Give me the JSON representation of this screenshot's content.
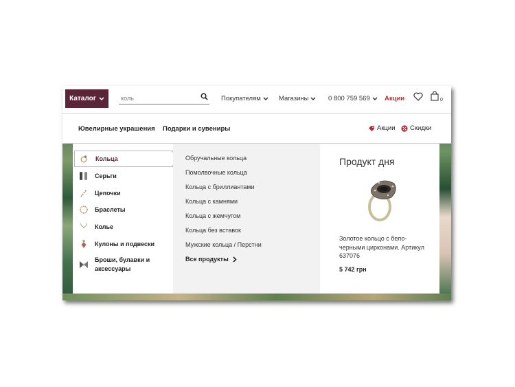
{
  "header": {
    "catalog_label": "Каталог",
    "search_placeholder": "коль",
    "nav": {
      "buyers": "Покупателям",
      "stores": "Магазины",
      "phone": "0 800 759 569",
      "promo": "Акции"
    },
    "cart_count": "0"
  },
  "category_bar": {
    "jewelry": "Ювелирные украшения",
    "gifts": "Подарки и сувениры",
    "promotions": "Акции",
    "discounts": "Скидки"
  },
  "menu": {
    "categories": [
      {
        "label": "Кольца",
        "icon": "ring-icon"
      },
      {
        "label": "Серьги",
        "icon": "earrings-icon"
      },
      {
        "label": "Цепочки",
        "icon": "chain-icon"
      },
      {
        "label": "Браслеты",
        "icon": "bracelet-icon"
      },
      {
        "label": "Колье",
        "icon": "necklace-icon"
      },
      {
        "label": "Кулоны и подвески",
        "icon": "pendant-icon"
      },
      {
        "label": "Броши, булавки и аксессуары",
        "icon": "brooch-icon"
      }
    ],
    "subcategories": [
      "Обручальные кольца",
      "Помолвочные кольца",
      "Кольца с бриллиантами",
      "Кольца с камнями",
      "Кольца с жемчугом",
      "Кольца без вставок",
      "Мужские кольца / Перстни"
    ],
    "all_products": "Все продукты"
  },
  "product_of_day": {
    "title": "Продукт дня",
    "description": "Золотое кольцо с бело-черными цирконами. Артикул 637076",
    "price": "5 742 грн"
  },
  "colors": {
    "brand": "#5a2536",
    "promo": "#b0313b"
  }
}
